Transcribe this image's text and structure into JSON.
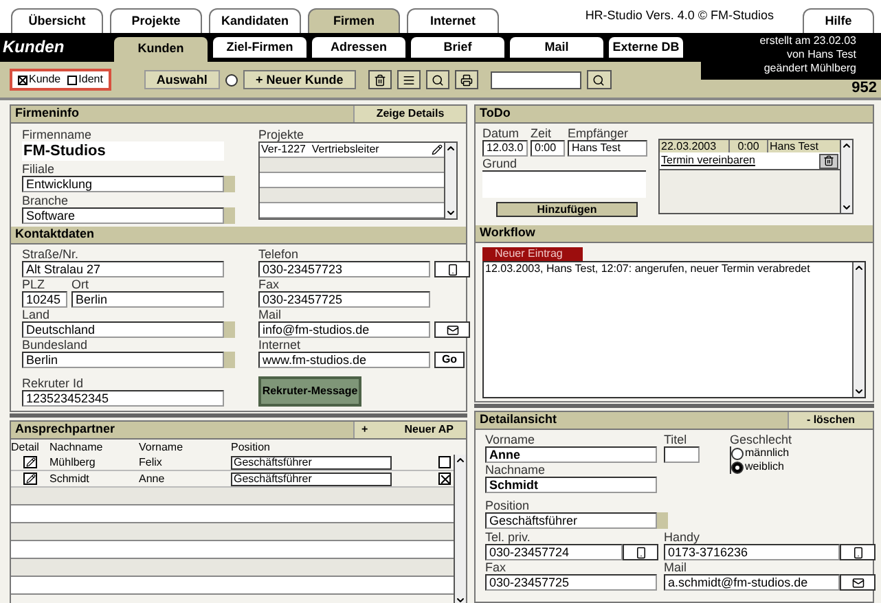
{
  "top_tabs": [
    {
      "label": "Übersicht",
      "selected": false
    },
    {
      "label": "Projekte",
      "selected": false
    },
    {
      "label": "Kandidaten",
      "selected": false
    },
    {
      "label": "Firmen",
      "selected": true
    },
    {
      "label": "Internet",
      "selected": false
    }
  ],
  "version": "HR-Studio Vers. 4.0 © FM-Studios",
  "help_tab": "Hilfe",
  "section_title": "Kunden",
  "sub_tabs": [
    {
      "label": "Kunden",
      "selected": true
    },
    {
      "label": "Ziel-Firmen",
      "selected": false
    },
    {
      "label": "Adressen",
      "selected": false
    },
    {
      "label": "Brief",
      "selected": false
    },
    {
      "label": "Mail",
      "selected": false
    },
    {
      "label": "Externe DB",
      "selected": false
    }
  ],
  "meta": [
    "erstellt am 23.02.03",
    "von Hans Test",
    "geändert Mühlberg"
  ],
  "toolbar": {
    "filters": [
      {
        "label": "Kunde",
        "checked": true
      },
      {
        "label": "Ident",
        "checked": false
      }
    ],
    "select_button": "Auswahl",
    "select_radio": false,
    "new_button": "+ Neuer Kunde",
    "count": "952"
  },
  "firmeninfo": {
    "title": "Firmeninfo",
    "details_button": "Zeige Details",
    "fields": [
      {
        "kind": "large",
        "label": "Firmenname",
        "value": "FM-Studios"
      },
      {
        "kind": "dropdown",
        "label": "Filiale",
        "value": "Entwicklung"
      },
      {
        "kind": "dropdown",
        "label": "Branche",
        "value": "Software"
      }
    ],
    "projects_label": "Projekte",
    "projects": [
      "Ver-1227  Vertriebsleiter"
    ]
  },
  "kontakt": {
    "title": "Kontaktdaten",
    "left": [
      {
        "kind": "text",
        "label": "Straße/Nr.",
        "value": "Alt Stralau 27"
      },
      {
        "kind": "pair",
        "parts": [
          {
            "label": "PLZ",
            "value": "10245"
          },
          {
            "label": "Ort",
            "value": "Berlin"
          }
        ]
      },
      {
        "kind": "dropdown",
        "label": "Land",
        "value": "Deutschland"
      },
      {
        "kind": "dropdown",
        "label": "Bundesland",
        "value": "Berlin"
      }
    ],
    "right": [
      {
        "kind": "phone",
        "label": "Telefon",
        "value": "030-23457723"
      },
      {
        "kind": "plain",
        "label": "Fax",
        "value": "030-23457725"
      },
      {
        "kind": "mail",
        "label": "Mail",
        "value": "info@fm-studios.de"
      },
      {
        "kind": "link",
        "label": "Internet",
        "value": "www.fm-studios.de",
        "button": "Go"
      }
    ],
    "recruiter_label": "Rekruter Id",
    "recruiter_value": "123523452345",
    "message_button": "Rekruter-Message"
  },
  "todo": {
    "title": "ToDo",
    "labels": [
      "Datum",
      "Zeit",
      "Empfänger"
    ],
    "values": [
      "12.03.0",
      "0:00",
      "Hans Test"
    ],
    "reason_label": "Grund",
    "add_button": "Hinzufügen",
    "items": [
      {
        "date": "22.03.2003",
        "time": "0:00",
        "person": "Hans Test",
        "text": "Termin vereinbaren"
      }
    ]
  },
  "workflow": {
    "title": "Workflow",
    "tab": "Neuer Eintrag",
    "entries": [
      "12.03.2003, Hans Test, 12:07: angerufen, neuer Termin verabredet"
    ]
  },
  "contacts": {
    "title": "Ansprechpartner",
    "new_sign": "+",
    "new_button": "Neuer AP",
    "columns": [
      "Detail",
      "Nachname",
      "Vorname",
      "Position"
    ],
    "rows": [
      {
        "last": "Mühlberg",
        "first": "Felix",
        "position": "Geschäftsführer",
        "selected": false
      },
      {
        "last": "Schmidt",
        "first": "Anne",
        "position": "Geschäftsführer",
        "selected": true
      }
    ]
  },
  "detail": {
    "title": "Detailansicht",
    "delete_button": "- löschen",
    "first_label": "Vorname",
    "first": "Anne",
    "title_label": "Titel",
    "gender_label": "Geschlecht",
    "genders": [
      {
        "label": "männlich",
        "selected": false
      },
      {
        "label": "weiblich",
        "selected": true
      }
    ],
    "last_label": "Nachname",
    "last": "Schmidt",
    "position_label": "Position",
    "position": "Geschäftsführer",
    "fields": [
      {
        "kind": "phone",
        "label": "Tel. priv.",
        "value": "030-23457724"
      },
      {
        "kind": "phone",
        "label": "Handy",
        "value": "0173-3716236"
      },
      {
        "kind": "plain",
        "label": "Fax",
        "value": "030-23457725"
      },
      {
        "kind": "mail",
        "label": "Mail",
        "value": "a.schmidt@fm-studios.de"
      }
    ]
  }
}
